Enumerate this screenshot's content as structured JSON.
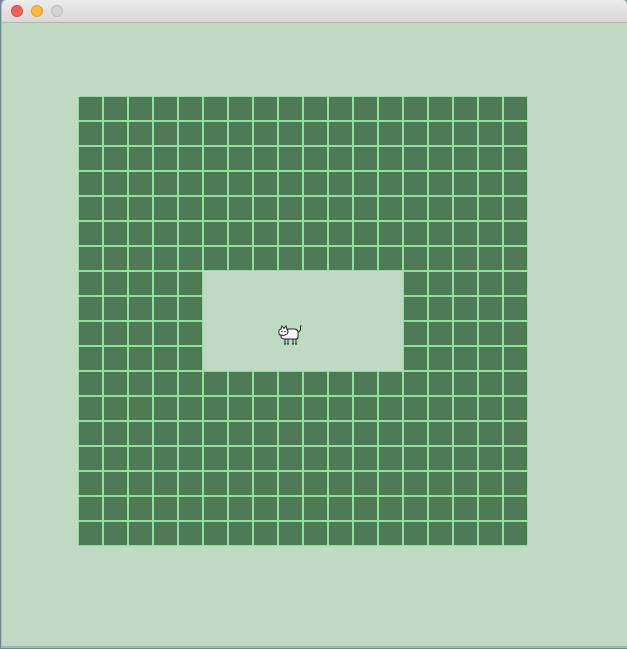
{
  "window": {
    "buttons": [
      {
        "name": "close-button",
        "color": "#fc605b",
        "border": "#de4a44"
      },
      {
        "name": "minimize-button",
        "color": "#fdbc40",
        "border": "#dea235"
      },
      {
        "name": "zoom-button",
        "color": "#d3d3d3",
        "border": "#bdbdbd"
      }
    ]
  },
  "game": {
    "grid_columns": 18,
    "grid_rows": 18,
    "open_area": {
      "col_start": 5,
      "col_end": 12,
      "row_start": 7,
      "row_end": 10
    },
    "tile_color": "#4e7a55",
    "tile_border_color": "#8ee09a",
    "background_color": "#c0d9c2",
    "player": {
      "sprite": "cat-icon",
      "col": 8,
      "row": 9
    }
  }
}
